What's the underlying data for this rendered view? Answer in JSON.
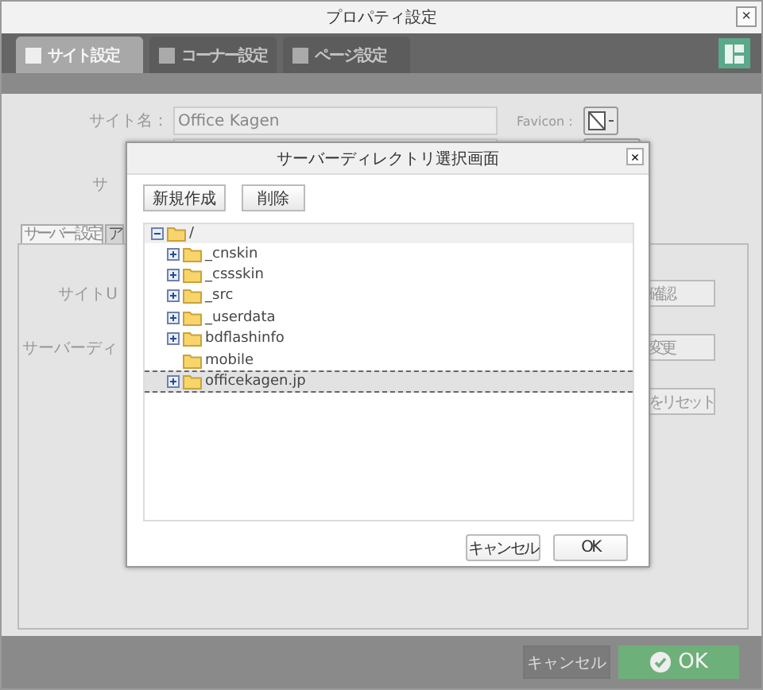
{
  "window": {
    "title": "プロパティ設定",
    "close": "×"
  },
  "tabs": [
    {
      "label": "サイト設定",
      "selected": true
    },
    {
      "label": "コーナー設定",
      "selected": false
    },
    {
      "label": "ページ設定",
      "selected": false
    }
  ],
  "form": {
    "site_name_label": "サイト名：",
    "site_name_value": "Office Kagen",
    "favicon_label": "Favicon :",
    "row3_label": "サ"
  },
  "sub_tabs": [
    {
      "label": "サーバー設定",
      "selected": true
    },
    {
      "label": "ア",
      "selected": false
    }
  ],
  "server_rows": [
    {
      "label": "サイトU",
      "button": "確認"
    },
    {
      "label": "サーバーディ",
      "button": "変更"
    },
    {
      "button": "をリセット"
    }
  ],
  "dialog": {
    "title": "サーバーディレクトリ選択画面",
    "close": "×",
    "toolbar": [
      "新規作成",
      "削除"
    ],
    "tree": {
      "label": "/",
      "expanded": true,
      "selected": false,
      "children": [
        {
          "label": "_cnskin",
          "expanded": false,
          "selected": false
        },
        {
          "label": "_cssskin",
          "expanded": false,
          "selected": false
        },
        {
          "label": "_src",
          "expanded": false,
          "selected": false
        },
        {
          "label": "_userdata",
          "expanded": false,
          "selected": false
        },
        {
          "label": "bdflashinfo",
          "expanded": false,
          "selected": false
        },
        {
          "label": "mobile",
          "selected": false
        },
        {
          "label": "officekagen.jp",
          "expanded": false,
          "selected": true
        }
      ]
    },
    "buttons": [
      "キャンセル",
      "OK"
    ]
  },
  "footer": {
    "cancel": "キャンセル",
    "ok": "OK"
  }
}
